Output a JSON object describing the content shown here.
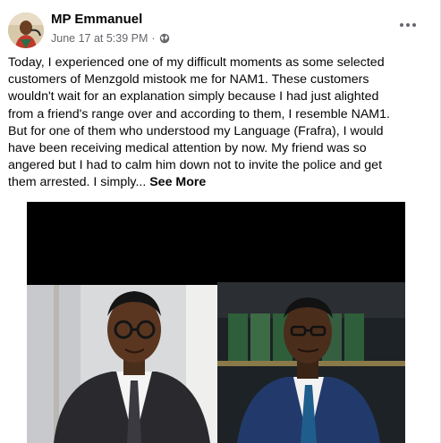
{
  "post": {
    "author": "MP Emmanuel",
    "timestamp": "June 17 at 5:39 PM",
    "separator": "·",
    "audience_icon": "globe-icon",
    "options_icon": "more-options-icon",
    "text_lines": [
      "Today, I experienced one of my difficult moments as some selected",
      "customers of Menzgold mistook me for  NAM1. These customers",
      "wouldn't wait for an explanation simply because I had just alighted",
      "from a friend's range over and according to them, I resemble NAM1.",
      "But for one of them who understood my Language (Frafra), I would",
      "have been receiving medical attention by now. My friend was so",
      "angered but I had to calm him down not to invite the police and get",
      "them arrested. I simply... "
    ],
    "see_more": "See More"
  },
  "colors": {
    "text": "#050505",
    "secondary": "#65676b",
    "background": "#ffffff",
    "photo_bg": "#000000"
  }
}
